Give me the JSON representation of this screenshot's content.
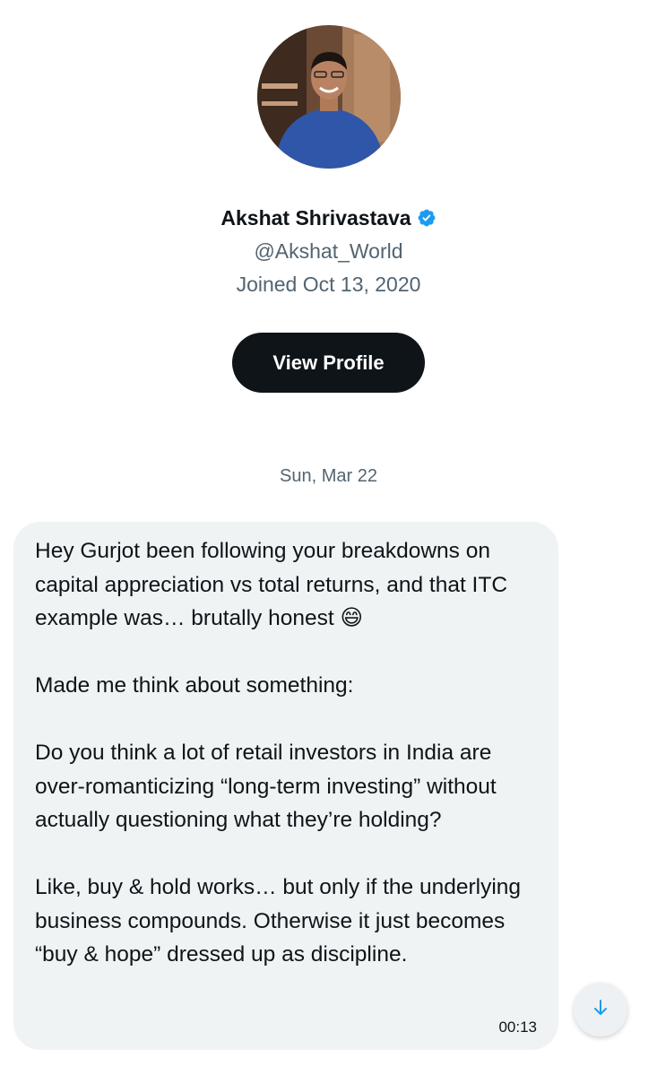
{
  "profile": {
    "name": "Akshat Shrivastava",
    "handle": "@Akshat_World",
    "joined": "Joined Oct 13, 2020",
    "view_profile_label": "View Profile",
    "verified_icon": "verified-badge-icon",
    "verified_color": "#1d9bf0"
  },
  "conversation": {
    "date_separator": "Sun, Mar 22",
    "message": {
      "paragraphs": [
        "Hey Gurjot been following your breakdowns on capital appreciation vs total returns, and that ITC example was… brutally honest 😄",
        "Made me think about something:",
        "Do you think a lot of retail investors in India are over-romanticizing “long-term investing” without actually questioning what they’re holding?",
        "Like, buy & hold works… but only if the underlying business compounds. Otherwise it just becomes “buy & hope” dressed up as discipline."
      ],
      "time": "00:13"
    }
  },
  "controls": {
    "scroll_down_icon": "arrow-down-icon",
    "accent_color": "#1d9bf0"
  }
}
